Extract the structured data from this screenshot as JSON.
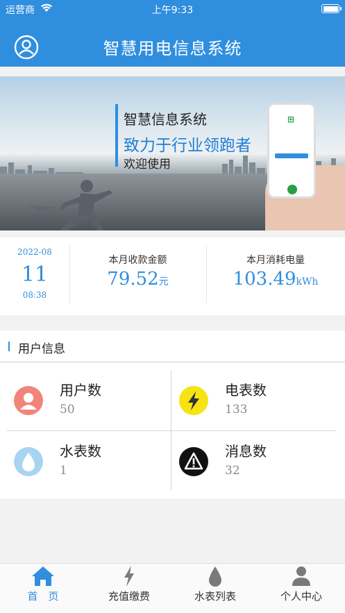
{
  "status_bar": {
    "carrier": "运营商",
    "time": "上午9:33"
  },
  "header": {
    "title": "智慧用电信息系统"
  },
  "banner": {
    "line1": "智慧信息系统",
    "line2": "致力于行业领跑者",
    "line3": "欢迎使用"
  },
  "summary": {
    "date_ym": "2022-08",
    "date_day": "11",
    "date_time": "08:38",
    "payment_label": "本月收款金额",
    "payment_value": "79.52",
    "payment_unit": "元",
    "consumption_label": "本月消耗电量",
    "consumption_value": "103.49",
    "consumption_unit": "kWh"
  },
  "user_info": {
    "title": "用户信息",
    "tiles": [
      {
        "label": "用户数",
        "value": "50",
        "icon": "user-icon",
        "color": "#f2857a"
      },
      {
        "label": "电表数",
        "value": "133",
        "icon": "lightning-icon",
        "color": "#f5e412"
      },
      {
        "label": "水表数",
        "value": "1",
        "icon": "water-drop-icon",
        "color": "#a8d4f2"
      },
      {
        "label": "消息数",
        "value": "32",
        "icon": "warning-icon",
        "color": "#111111"
      }
    ]
  },
  "tabbar": {
    "items": [
      {
        "label": "首　页",
        "icon": "home-icon",
        "active": true
      },
      {
        "label": "充值缴费",
        "icon": "lightning-icon",
        "active": false
      },
      {
        "label": "水表列表",
        "icon": "water-drop-icon",
        "active": false
      },
      {
        "label": "个人中心",
        "icon": "person-icon",
        "active": false
      }
    ]
  },
  "colors": {
    "primary": "#2f8ede",
    "tab_inactive": "#7a7a7a"
  }
}
